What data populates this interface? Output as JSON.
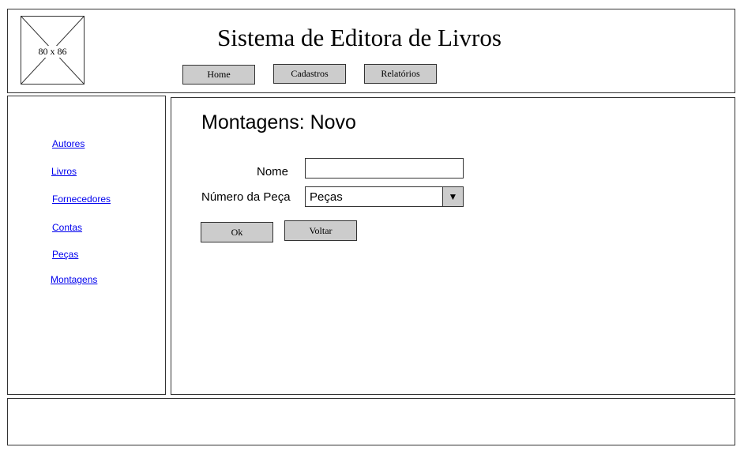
{
  "header": {
    "logo_placeholder": "80 x 86",
    "title": "Sistema de Editora de Livros",
    "nav": [
      "Home",
      "Cadastros",
      "Relatórios"
    ]
  },
  "sidebar": {
    "links": [
      "Autores",
      "Livros",
      "Fornecedores",
      "Contas",
      "Peças",
      "Montagens"
    ]
  },
  "main": {
    "heading": "Montagens: Novo",
    "form": {
      "nome_label": "Nome",
      "nome_value": "",
      "peca_label": "Número da Peça",
      "peca_selected": "Peças",
      "ok_label": "Ok",
      "voltar_label": "Voltar"
    }
  },
  "icons": {
    "dropdown": "triangle-down-icon"
  }
}
